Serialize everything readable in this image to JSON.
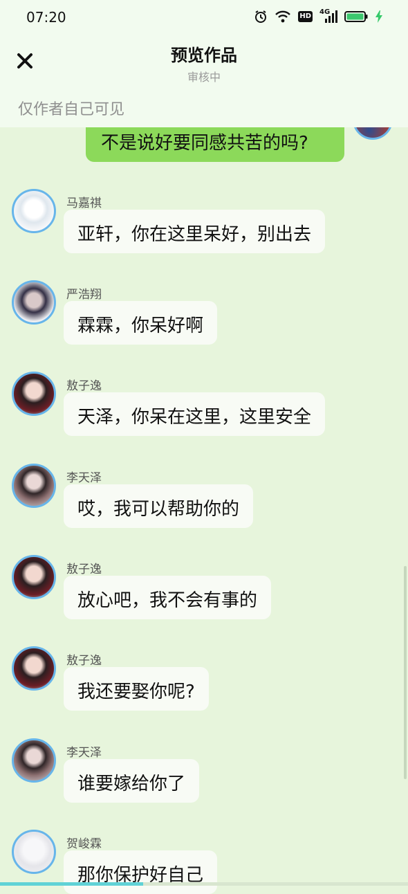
{
  "status_bar": {
    "time": "07:20",
    "hd_label": "HD",
    "network_label": "4G",
    "icons": [
      "alarm-icon",
      "wifi-icon",
      "hd-icon",
      "signal-icon",
      "battery-icon",
      "charging-icon"
    ]
  },
  "header": {
    "title": "预览作品",
    "subtitle": "审核中",
    "visibility": "仅作者自己可见",
    "close_icon": "close-icon"
  },
  "chat": {
    "my_message": "不是说好要同感共苦的吗?",
    "messages": [
      {
        "sender": "马嘉祺",
        "text": "亚轩，你在这里呆好，别出去"
      },
      {
        "sender": "严浩翔",
        "text": "霖霖，你呆好啊"
      },
      {
        "sender": "敖子逸",
        "text": "天泽，你呆在这里，这里安全"
      },
      {
        "sender": "李天泽",
        "text": "哎，我可以帮助你的"
      },
      {
        "sender": "敖子逸",
        "text": "放心吧，我不会有事的"
      },
      {
        "sender": "敖子逸",
        "text": "我还要娶你呢?"
      },
      {
        "sender": "李天泽",
        "text": "谁要嫁给你了"
      },
      {
        "sender": "贺峻霖",
        "text": "那你保护好自己"
      }
    ]
  },
  "reading_progress": 0.35,
  "colors": {
    "background": "#e7f5dc",
    "my_bubble": "#8cd95a",
    "other_bubble": "#f8fbf5",
    "avatar_ring": "#67b5ea",
    "progress": "#5fd2d6"
  }
}
